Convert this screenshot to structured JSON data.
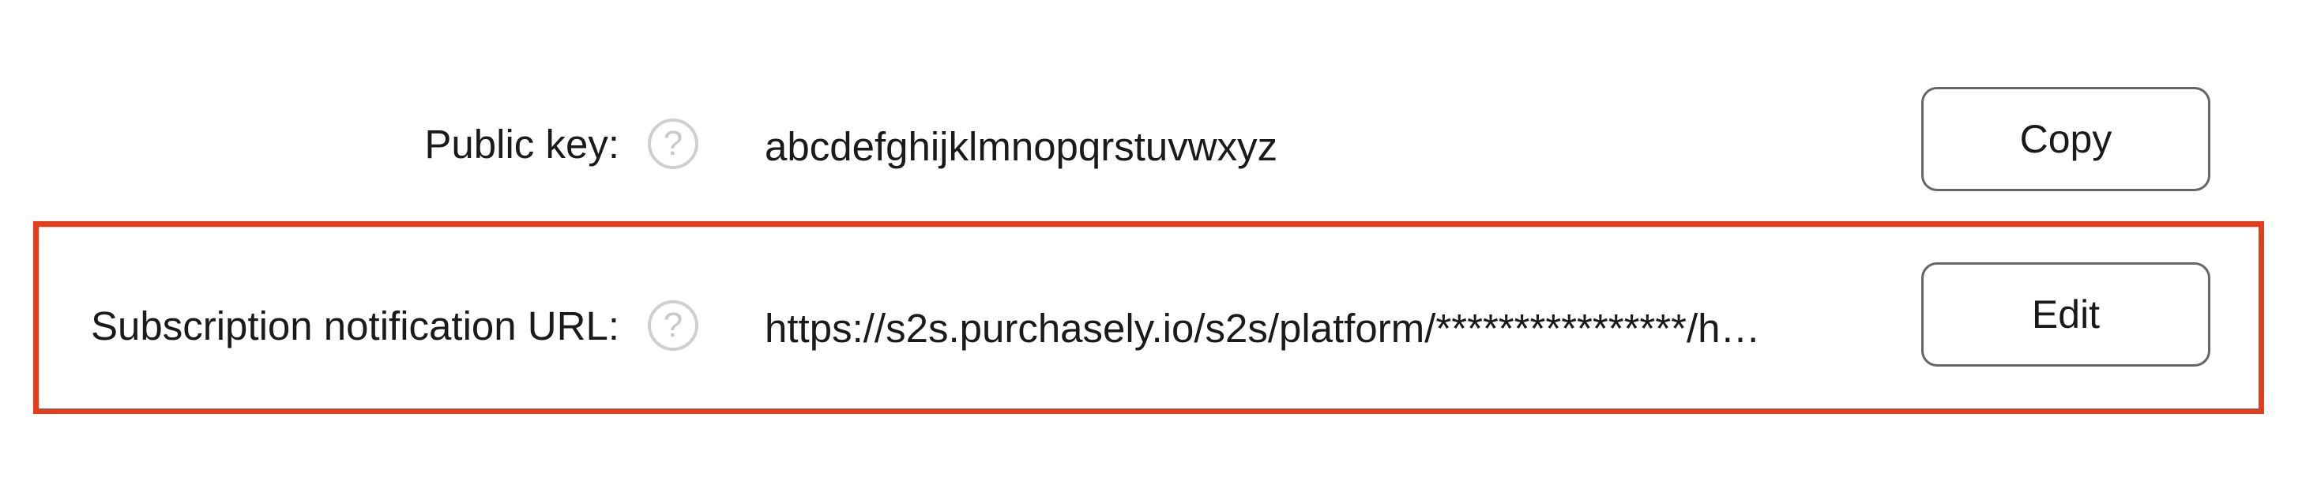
{
  "settings": {
    "rows": [
      {
        "label": "Public key:",
        "help_icon": "question-circle-icon",
        "help_glyph": "?",
        "value": "abcdefghijklmnopqrstuvwxyz",
        "action_label": "Copy"
      },
      {
        "label": "Subscription notification URL:",
        "help_icon": "question-circle-icon",
        "help_glyph": "?",
        "value": "https://s2s.purchasely.io/s2s/platform/****************/h…",
        "action_label": "Edit"
      }
    ]
  },
  "colors": {
    "highlight_border": "#e23e1e",
    "help_icon": "#cfcfcf",
    "button_border": "#666666",
    "text": "#1a1a1a"
  }
}
